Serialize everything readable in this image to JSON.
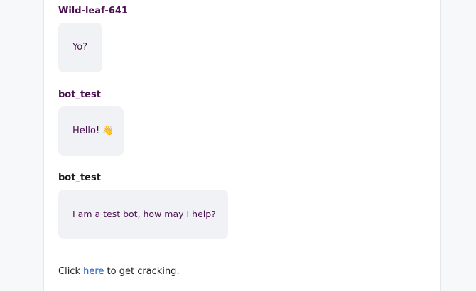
{
  "messages": [
    {
      "author": "Wild-leaf-641",
      "author_color": "#4a0f4f",
      "text": "Yo?"
    },
    {
      "author": "bot_test",
      "author_color": "#4a0f4f",
      "text": "Hello! 👋"
    },
    {
      "author": "bot_test",
      "author_color": "#1a1a1a",
      "text": "I am a test bot, how may I help?"
    }
  ],
  "footer": {
    "prefix": "Click ",
    "link_text": "here",
    "suffix": " to get cracking."
  },
  "colors": {
    "bubble_bg": "#f1f2f6",
    "message_text": "#4a0f4f",
    "link": "#1f5fbf"
  }
}
